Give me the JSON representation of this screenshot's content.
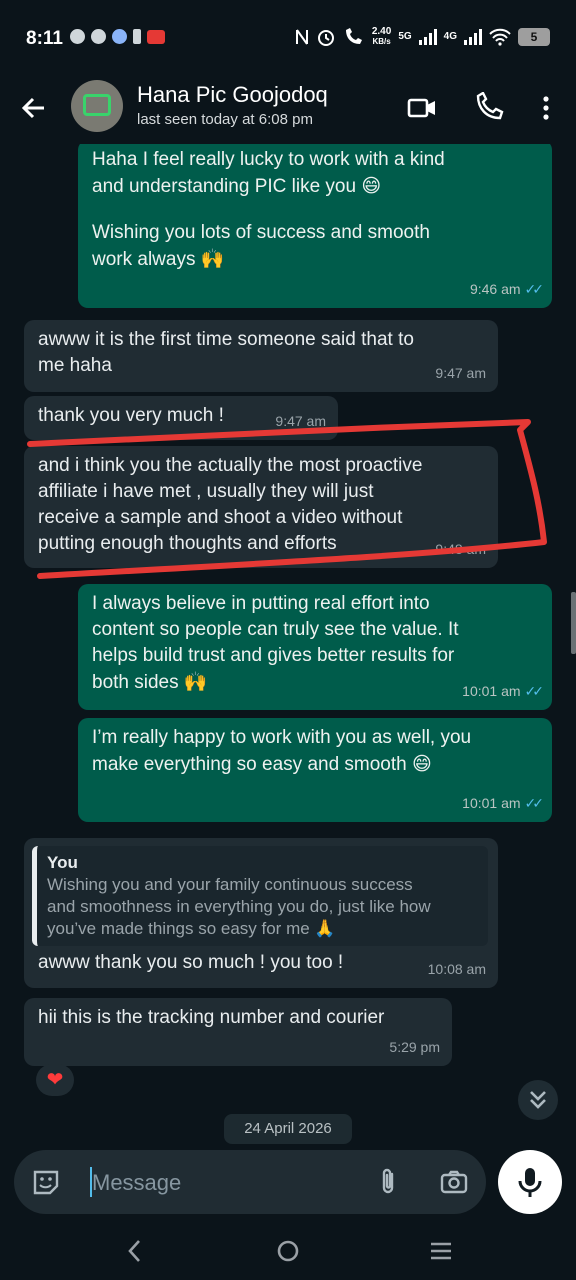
{
  "status_bar": {
    "time": "8:11",
    "speed": "2.40",
    "speed_unit": "KB/s",
    "net1": "5G",
    "net2": "4G",
    "battery": "5"
  },
  "header": {
    "title": "Hana Pic Goojodoq",
    "subtitle": "last seen today at 6:08 pm"
  },
  "messages": [
    {
      "dir": "out",
      "lines": [
        "Haha I feel really lucky to work with a kind",
        "and understanding PIC like you"
      ],
      "emoji": "😄",
      "lines2": [
        "Wishing you lots of success and smooth",
        "work always"
      ],
      "emoji2": "🙌",
      "time": "9:46 am"
    },
    {
      "dir": "in",
      "lines": [
        "awww it is the first time someone said that to",
        "me haha"
      ],
      "time": "9:47 am"
    },
    {
      "dir": "in",
      "lines": [
        "thank you very much !"
      ],
      "time": "9:47 am"
    },
    {
      "dir": "in",
      "lines": [
        "and i think you the actually the most proactive",
        "affiliate i have met , usually they will just",
        "receive a sample and shoot a video without",
        "putting enough thoughts and efforts"
      ],
      "time": "9:48 am"
    },
    {
      "dir": "out",
      "lines": [
        "I always believe in putting real effort into",
        "content so people can truly see the value. It",
        "helps build trust and gives better results for",
        "both sides"
      ],
      "emoji": "🙌",
      "time": "10:01 am"
    },
    {
      "dir": "out",
      "lines": [
        "I’m really happy to work with you as well, you",
        "make everything so easy and smooth"
      ],
      "emoji": "😄",
      "time": "10:01 am"
    },
    {
      "dir": "in",
      "reply_name": "You",
      "reply_lines": [
        "Wishing you and your family continuous success",
        "and smoothness in everything you do, just like how",
        "you’ve made things so easy for me"
      ],
      "reply_emoji": "🙏",
      "lines": [
        "awww thank you so much ! you too !"
      ],
      "time": "10:08 am"
    },
    {
      "dir": "in",
      "lines": [
        "hii this is the tracking number and courier"
      ],
      "time": "5:29 pm"
    }
  ],
  "reaction": "❤",
  "date_pill": "24 April 2026",
  "input": {
    "placeholder": "Message"
  },
  "colors": {
    "outgoing": "#005c4b",
    "incoming": "#202c33",
    "background": "#0b141a",
    "ticks": "#53bdeb",
    "annotation": "#e53935"
  }
}
